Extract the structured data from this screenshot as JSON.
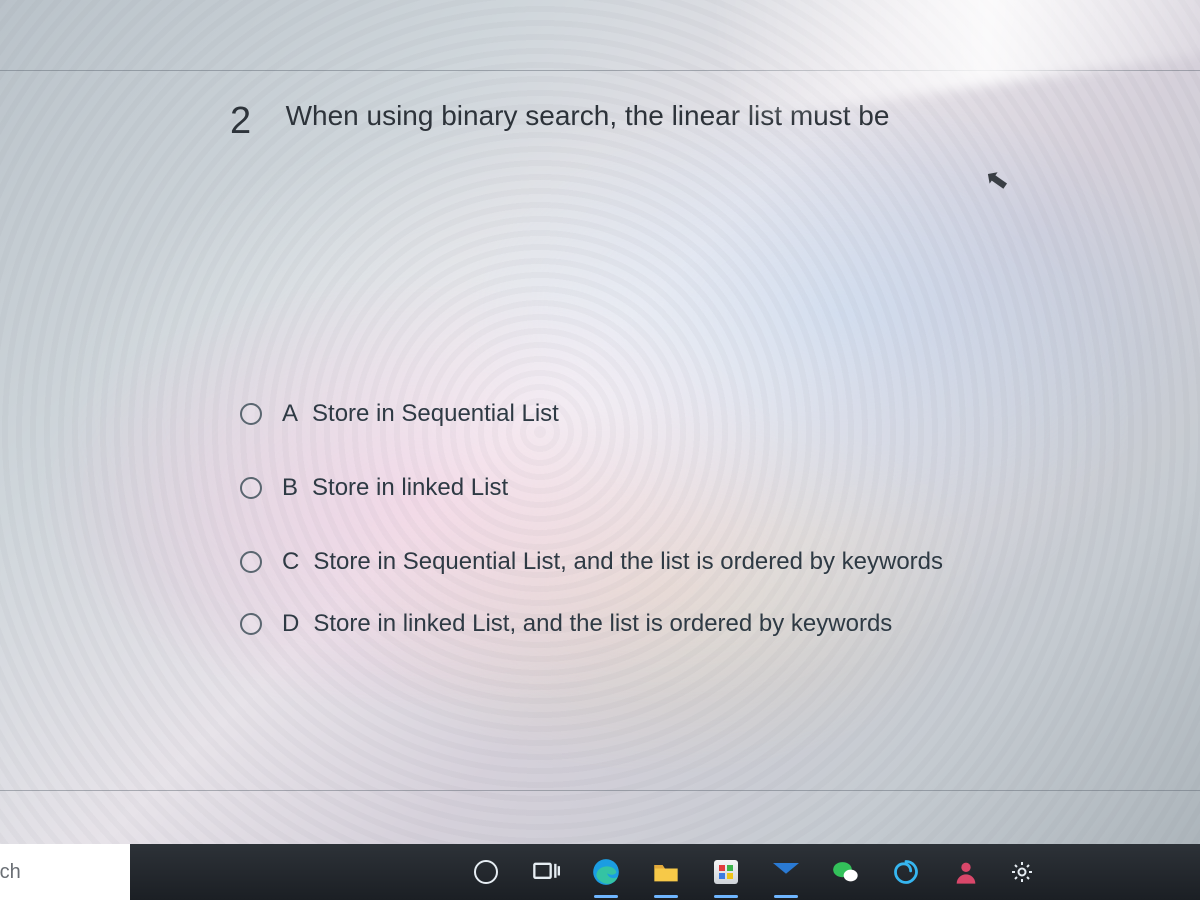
{
  "question": {
    "number": "2",
    "text": "When using binary search, the linear list must be"
  },
  "options": [
    {
      "letter": "A",
      "text": "Store in Sequential List"
    },
    {
      "letter": "B",
      "text": "Store in linked List"
    },
    {
      "letter": "C",
      "text": "Store in Sequential List, and the list is ordered by keywords"
    },
    {
      "letter": "D",
      "text": "Store in linked List, and the list is ordered by keywords"
    }
  ],
  "taskbar": {
    "search_placeholder": "ere to search"
  }
}
